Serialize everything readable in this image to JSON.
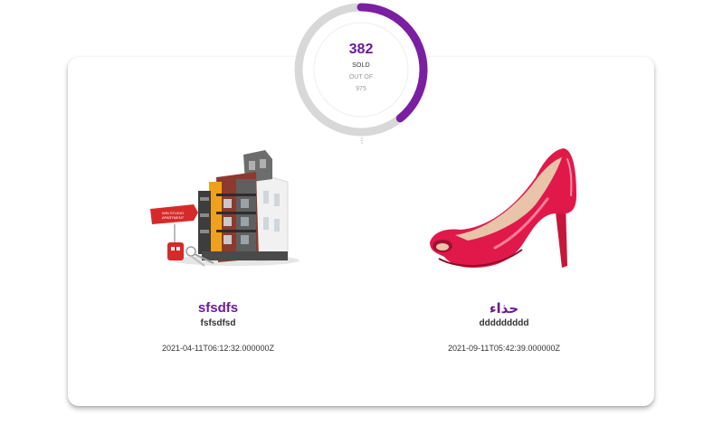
{
  "gauge": {
    "sold_count": "382",
    "sold_label": "SOLD",
    "out_of_label": "OUT OF",
    "total": "975",
    "progress_fraction": 0.392,
    "colors": {
      "track": "#d8d8d8",
      "progress": "#7b1fa2",
      "count_text": "#6a1b9a"
    }
  },
  "products": [
    {
      "name": "sfsdfs",
      "description": "fsfsdfsd",
      "date": "2021-04-11T06:12:32.000000Z",
      "image_icon": "apartment-building-image",
      "sign_text": "WIN STUDIO APARTMENT"
    },
    {
      "name": "حذاء",
      "description": "ddddddddd",
      "date": "2021-09-11T05:42:39.000000Z",
      "image_icon": "red-high-heel-shoe-image"
    }
  ],
  "accent_color": "#6a1b9a"
}
